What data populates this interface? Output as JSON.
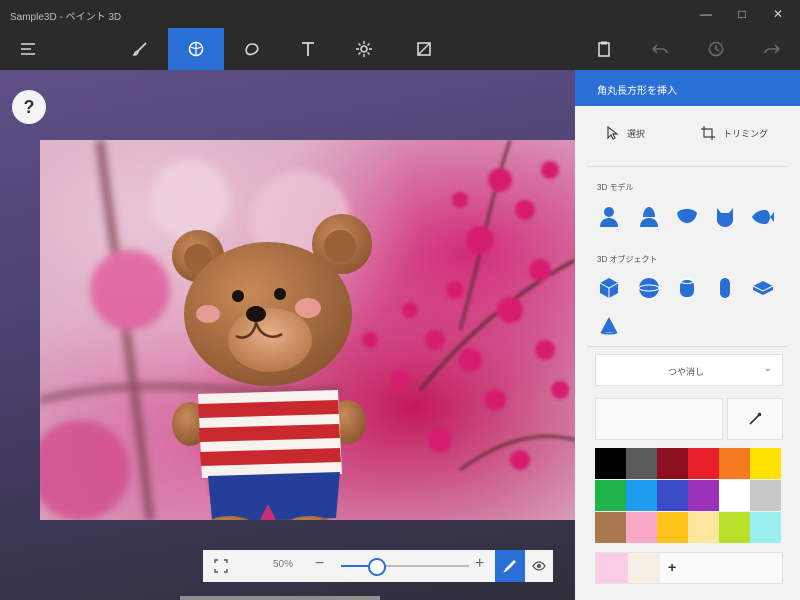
{
  "window": {
    "title": "Sample3D - ペイント 3D",
    "controls": [
      "—",
      "□",
      "✕"
    ]
  },
  "toolbar": {
    "tools": [
      {
        "name": "menu",
        "icon": "hamburger-menu-icon"
      },
      {
        "name": "brushes",
        "icon": "brush-icon"
      },
      {
        "name": "3d-shapes",
        "icon": "3d-shape-icon",
        "active": true
      },
      {
        "name": "2d-shapes",
        "icon": "2d-shape-icon"
      },
      {
        "name": "text",
        "icon": "text-icon"
      },
      {
        "name": "effects",
        "icon": "effects-icon"
      },
      {
        "name": "canvas",
        "icon": "canvas-icon"
      }
    ],
    "right": [
      {
        "name": "paste",
        "icon": "paste-icon"
      },
      {
        "name": "undo",
        "icon": "undo-icon"
      },
      {
        "name": "history",
        "icon": "history-icon"
      },
      {
        "name": "redo",
        "icon": "redo-icon"
      }
    ]
  },
  "help": {
    "label": "?"
  },
  "zoom": {
    "percent_label": "50%",
    "minus": "−",
    "plus": "+",
    "level": 0.27
  },
  "panel": {
    "header": "角丸長方形を挿入",
    "tabs": [
      {
        "label": "選択",
        "icon": "select-icon"
      },
      {
        "label": "トリミング",
        "icon": "crop-icon"
      }
    ],
    "section_models": "3D モデル",
    "section_objects": "3D オブジェクト",
    "dropdown_value": "つや消し",
    "dropdown_chevron": "⌄",
    "add_label": "+"
  },
  "colors": {
    "accent": "#2a6fd6",
    "palette": [
      "#000000",
      "#5a5a5a",
      "#8b0f1f",
      "#e8202a",
      "#f47b20",
      "#ffe200",
      "#1fb34b",
      "#1f9cf0",
      "#3b4bc8",
      "#9b33b8",
      "#ffffff",
      "#c8c8c8",
      "#a9784e",
      "#f8a8c8",
      "#ffc21a",
      "#fde6a0",
      "#b8e02a",
      "#9af0f0"
    ],
    "recent": [
      "#f9cde3",
      "#f5efe6"
    ]
  }
}
